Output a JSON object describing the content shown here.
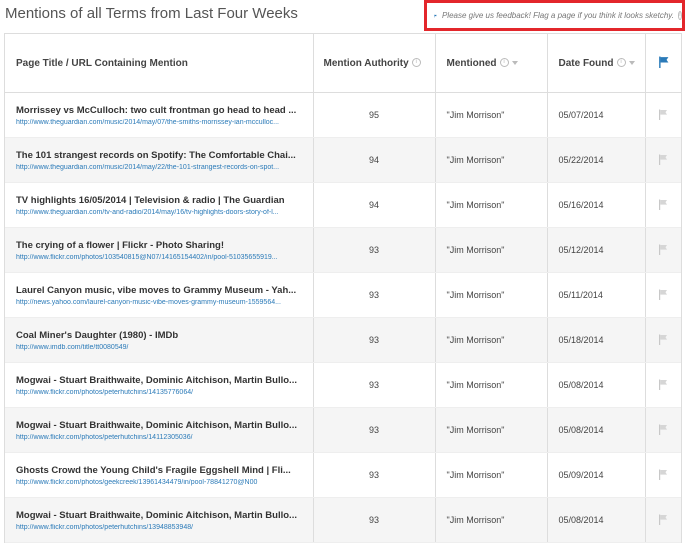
{
  "page": {
    "title": "Mentions of all Terms from Last Four Weeks"
  },
  "feedback": {
    "text": "Please give us feedback! Flag a page if you think it looks sketchy.",
    "info_symbol": "i"
  },
  "colors": {
    "flag_blue": "#2a7ab8",
    "flag_grey": "#c8c8c8",
    "url_link": "#2a7ab8",
    "feedback_border": "#e3262b"
  },
  "table": {
    "headers": {
      "page": "Page Title / URL Containing Mention",
      "authority": "Mention Authority",
      "mentioned": "Mentioned",
      "date": "Date Found",
      "info_symbol": "i"
    },
    "rows": [
      {
        "title": "Morrissey vs McCulloch: two cult frontman go head to head ...",
        "url": "http://www.theguardian.com/music/2014/may/07/the-smiths-morrissey-ian-mcculloc...",
        "authority": "95",
        "mentioned": "\"Jim Morrison\"",
        "date": "05/07/2014"
      },
      {
        "title": "The 101 strangest records on Spotify: The Comfortable Chai...",
        "url": "http://www.theguardian.com/music/2014/may/22/the-101-strangest-records-on-spot...",
        "authority": "94",
        "mentioned": "\"Jim Morrison\"",
        "date": "05/22/2014"
      },
      {
        "title": "TV highlights 16/05/2014 | Television & radio | The Guardian",
        "url": "http://www.theguardian.com/tv-and-radio/2014/may/16/tv-highlights-doors-story-of-l...",
        "authority": "94",
        "mentioned": "\"Jim Morrison\"",
        "date": "05/16/2014"
      },
      {
        "title": "The crying of a flower | Flickr - Photo Sharing!",
        "url": "http://www.flickr.com/photos/103540815@N07/14165154402/in/pool-51035655919...",
        "authority": "93",
        "mentioned": "\"Jim Morrison\"",
        "date": "05/12/2014"
      },
      {
        "title": "Laurel Canyon music, vibe moves to Grammy Museum - Yah...",
        "url": "http://news.yahoo.com/laurel-canyon-music-vibe-moves-grammy-museum-1559564...",
        "authority": "93",
        "mentioned": "\"Jim Morrison\"",
        "date": "05/11/2014"
      },
      {
        "title": "Coal Miner's Daughter (1980) - IMDb",
        "url": "http://www.imdb.com/title/tt0080549/",
        "authority": "93",
        "mentioned": "\"Jim Morrison\"",
        "date": "05/18/2014"
      },
      {
        "title": "Mogwai - Stuart Braithwaite, Dominic Aitchison, Martin Bullo...",
        "url": "http://www.flickr.com/photos/peterhutchins/14135776064/",
        "authority": "93",
        "mentioned": "\"Jim Morrison\"",
        "date": "05/08/2014"
      },
      {
        "title": "Mogwai - Stuart Braithwaite, Dominic Aitchison, Martin Bullo...",
        "url": "http://www.flickr.com/photos/peterhutchins/14112305036/",
        "authority": "93",
        "mentioned": "\"Jim Morrison\"",
        "date": "05/08/2014"
      },
      {
        "title": "Ghosts Crowd the Young Child's Fragile Eggshell Mind | Fli...",
        "url": "http://www.flickr.com/photos/geekcreek/13961434479/in/pool-78841270@N00",
        "authority": "93",
        "mentioned": "\"Jim Morrison\"",
        "date": "05/09/2014"
      },
      {
        "title": "Mogwai - Stuart Braithwaite, Dominic Aitchison, Martin Bullo...",
        "url": "http://www.flickr.com/photos/peterhutchins/13948853948/",
        "authority": "93",
        "mentioned": "\"Jim Morrison\"",
        "date": "05/08/2014"
      }
    ]
  }
}
